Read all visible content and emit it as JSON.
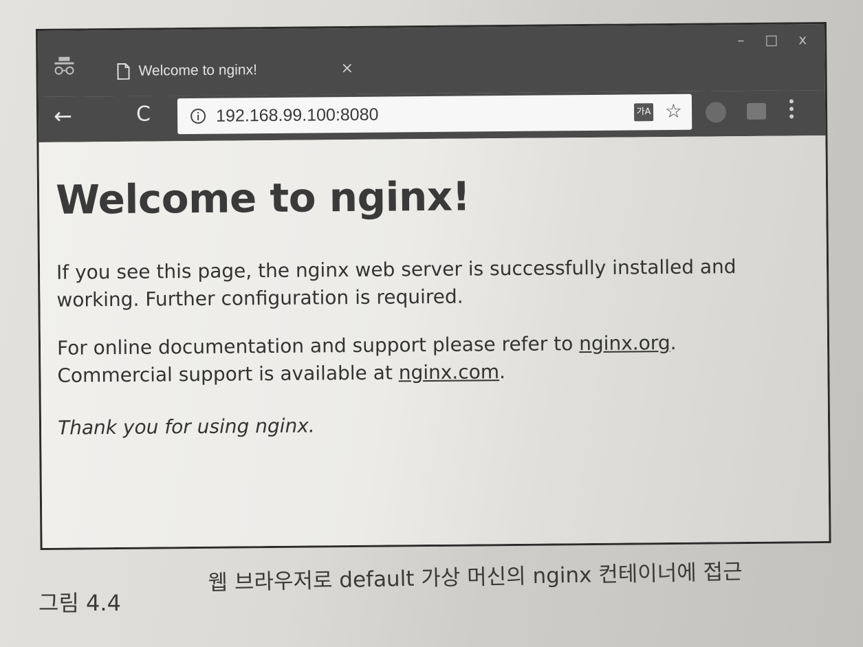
{
  "browser": {
    "tab": {
      "title": "Welcome to nginx!",
      "close_glyph": "×"
    },
    "window_controls": {
      "minimize": "–",
      "maximize": "□",
      "close": "x"
    },
    "toolbar": {
      "back_glyph": "←",
      "reload_glyph": "C",
      "url": "192.168.99.100:8080",
      "translate_glyph": "가A",
      "star_glyph": "☆"
    }
  },
  "page": {
    "heading": "Welcome to nginx!",
    "para1": "If you see this page, the nginx web server is successfully installed and working. Further configuration is required.",
    "para2_prefix": "For online documentation and support please refer to ",
    "link_org": "nginx.org",
    "para2_mid": ".",
    "para2_line2_prefix": "Commercial support is available at ",
    "link_com": "nginx.com",
    "para2_end": ".",
    "thanks": "Thank you for using nginx."
  },
  "caption": {
    "label": "그림 4.4",
    "text": "웹 브라우저로 default 가상 머신의 nginx 컨테이너에 접근"
  },
  "colors": {
    "browser_chrome": "#4a4a4a",
    "page_text": "#333333"
  }
}
